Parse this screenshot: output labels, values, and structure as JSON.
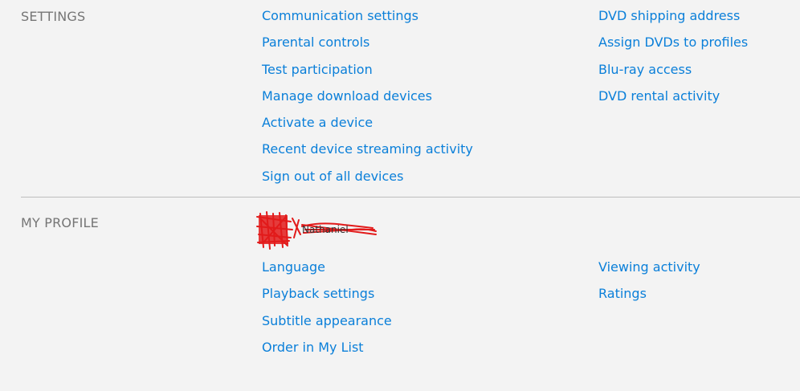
{
  "settings": {
    "title": "SETTINGS",
    "left_links": [
      "Communication settings",
      "Parental controls",
      "Test participation",
      "Manage download devices",
      "Activate a device",
      "Recent device streaming activity",
      "Sign out of all devices"
    ],
    "right_links": [
      "DVD shipping address",
      "Assign DVDs to profiles",
      "Blu-ray access",
      "DVD rental activity"
    ]
  },
  "profile": {
    "title": "MY PROFILE",
    "name": "Nathaniel",
    "left_links": [
      "Language",
      "Playback settings",
      "Subtitle appearance",
      "Order in My List"
    ],
    "right_links": [
      "Viewing activity",
      "Ratings"
    ]
  },
  "colors": {
    "link": "#0a7fd9",
    "section_title": "#757575",
    "background": "#f3f3f3",
    "redaction": "#e21a1a"
  }
}
